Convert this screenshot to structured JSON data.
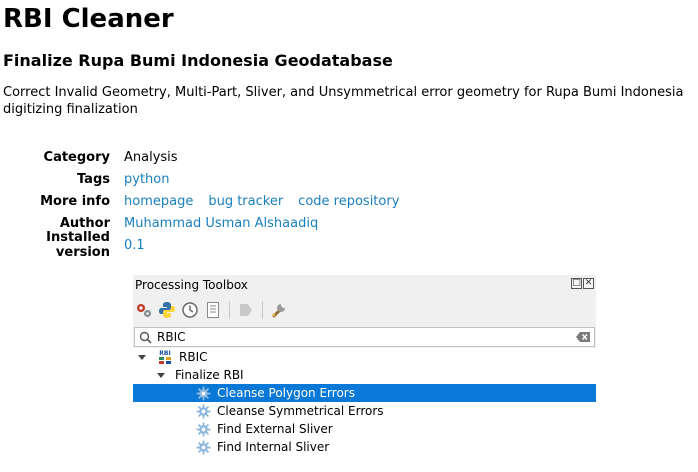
{
  "plugin": {
    "name": "RBI Cleaner",
    "tagline": "Finalize Rupa Bumi Indonesia Geodatabase",
    "description": "Correct Invalid Geometry, Multi-Part, Sliver, and Unsymmetrical error geometry for Rupa Bumi Indonesia digitizing finalization"
  },
  "meta": {
    "category_label": "Category",
    "category_value": "Analysis",
    "tags_label": "Tags",
    "tags_value": "python",
    "more_info_label": "More info",
    "links": [
      "homepage",
      "bug tracker",
      "code repository"
    ],
    "author_label": "Author",
    "author_value": "Muhammad Usman Alshaadiq",
    "version_label": "Installed version",
    "version_value": "0.1"
  },
  "toolbox": {
    "title": "Processing Toolbox",
    "search_value": "RBIC",
    "provider": "RBIC",
    "group": "Finalize RBI",
    "algorithms": [
      "Cleanse Polygon Errors",
      "Cleanse Symmetrical Errors",
      "Find External Sliver",
      "Find Internal Sliver"
    ],
    "selected_index": 0
  },
  "colors": {
    "link": "#1a7fbf",
    "selection": "#0a78d7"
  }
}
